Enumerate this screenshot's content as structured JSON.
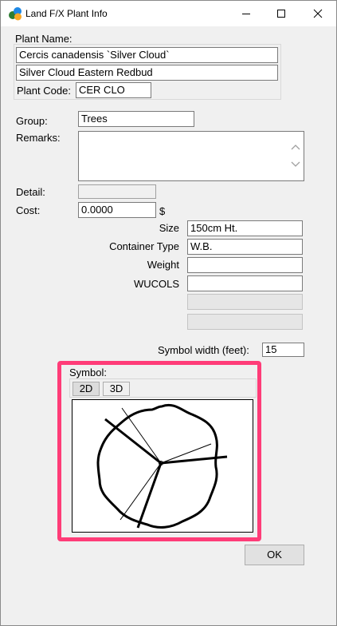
{
  "window": {
    "title": "Land F/X Plant Info"
  },
  "plant": {
    "name_label": "Plant Name:",
    "botanical_name": "Cercis canadensis `Silver Cloud`",
    "common_name": "Silver Cloud Eastern Redbud",
    "code_label": "Plant Code:",
    "code": "CER CLO"
  },
  "details": {
    "group_label": "Group:",
    "group": "Trees",
    "remarks_label": "Remarks:",
    "remarks": "",
    "detail_label": "Detail:",
    "detail": "",
    "cost_label": "Cost:",
    "cost": "0.0000",
    "currency": "$"
  },
  "attributes": {
    "size_label": "Size",
    "size": "150cm Ht.",
    "container_label": "Container Type",
    "container": "W.B.",
    "weight_label": "Weight",
    "weight": "",
    "wucols_label": "WUCOLS",
    "wucols": ""
  },
  "symbol": {
    "width_label": "Symbol width (feet):",
    "width": "15",
    "label": "Symbol:",
    "tabs": [
      "2D",
      "3D"
    ],
    "active_tab": "2D"
  },
  "buttons": {
    "ok": "OK"
  },
  "colors": {
    "highlight": "#ff3c78",
    "window_bg": "#f0f0f0",
    "titlebar_bg": "#ffffff"
  }
}
